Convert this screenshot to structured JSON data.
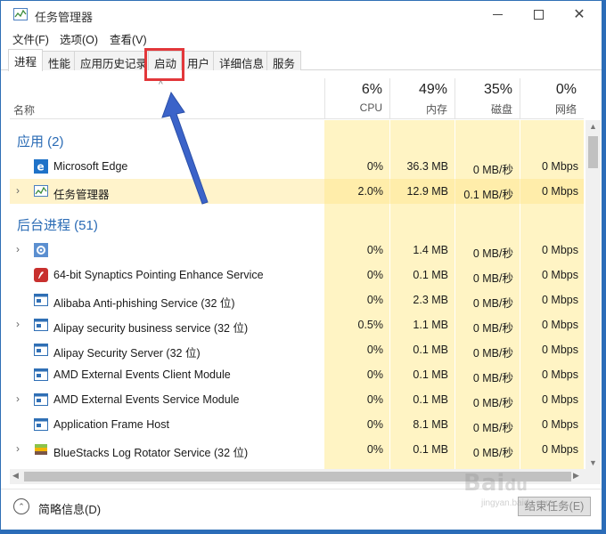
{
  "window": {
    "title": "任务管理器"
  },
  "menu": [
    "文件(F)",
    "选项(O)",
    "查看(V)"
  ],
  "tabs": [
    "进程",
    "性能",
    "应用历史记录",
    "启动",
    "用户",
    "详细信息",
    "服务"
  ],
  "header": {
    "name": "名称",
    "columns": [
      {
        "pct": "6%",
        "label": "CPU"
      },
      {
        "pct": "49%",
        "label": "内存"
      },
      {
        "pct": "35%",
        "label": "磁盘"
      },
      {
        "pct": "0%",
        "label": "网络"
      }
    ]
  },
  "groups": {
    "apps": "应用 (2)",
    "background": "后台进程 (51)"
  },
  "rows": [
    {
      "name": "Microsoft Edge",
      "icon": "edge-icon",
      "expand": false,
      "cpu": "0%",
      "mem": "36.3 MB",
      "disk": "0 MB/秒",
      "net": "0 Mbps"
    },
    {
      "name": "任务管理器",
      "icon": "task-manager-icon",
      "expand": true,
      "cpu": "2.0%",
      "mem": "12.9 MB",
      "disk": "0.1 MB/秒",
      "net": "0 Mbps"
    },
    {
      "name": "",
      "icon": "gear-icon",
      "expand": true,
      "cpu": "0%",
      "mem": "1.4 MB",
      "disk": "0 MB/秒",
      "net": "0 Mbps"
    },
    {
      "name": "64-bit Synaptics Pointing Enhance Service",
      "icon": "synaptics-icon",
      "expand": false,
      "cpu": "0%",
      "mem": "0.1 MB",
      "disk": "0 MB/秒",
      "net": "0 Mbps"
    },
    {
      "name": "Alibaba Anti-phishing Service (32 位)",
      "icon": "app-window-icon",
      "expand": false,
      "cpu": "0%",
      "mem": "2.3 MB",
      "disk": "0 MB/秒",
      "net": "0 Mbps"
    },
    {
      "name": "Alipay security business service (32 位)",
      "icon": "app-window-icon",
      "expand": true,
      "cpu": "0.5%",
      "mem": "1.1 MB",
      "disk": "0 MB/秒",
      "net": "0 Mbps"
    },
    {
      "name": "Alipay Security Server (32 位)",
      "icon": "app-window-icon",
      "expand": false,
      "cpu": "0%",
      "mem": "0.1 MB",
      "disk": "0 MB/秒",
      "net": "0 Mbps"
    },
    {
      "name": "AMD External Events Client Module",
      "icon": "app-window-icon",
      "expand": false,
      "cpu": "0%",
      "mem": "0.1 MB",
      "disk": "0 MB/秒",
      "net": "0 Mbps"
    },
    {
      "name": "AMD External Events Service Module",
      "icon": "app-window-icon",
      "expand": true,
      "cpu": "0%",
      "mem": "0.1 MB",
      "disk": "0 MB/秒",
      "net": "0 Mbps"
    },
    {
      "name": "Application Frame Host",
      "icon": "app-window-icon",
      "expand": false,
      "cpu": "0%",
      "mem": "8.1 MB",
      "disk": "0 MB/秒",
      "net": "0 Mbps"
    },
    {
      "name": "BlueStacks Log Rotator Service (32 位)",
      "icon": "bluestacks-icon",
      "expand": true,
      "cpu": "0%",
      "mem": "0.1 MB",
      "disk": "0 MB/秒",
      "net": "0 Mbps"
    }
  ],
  "footer": {
    "less_details": "简略信息(D)",
    "end_task": "结束任务(E)"
  },
  "watermark": {
    "brand": "Baidu",
    "site": "jingyan.baidu.com"
  },
  "colors": {
    "accent": "#2a6bb5",
    "highlight": "#e2373a",
    "heat": "#fff4c4",
    "arrow": "#3b63c9"
  }
}
